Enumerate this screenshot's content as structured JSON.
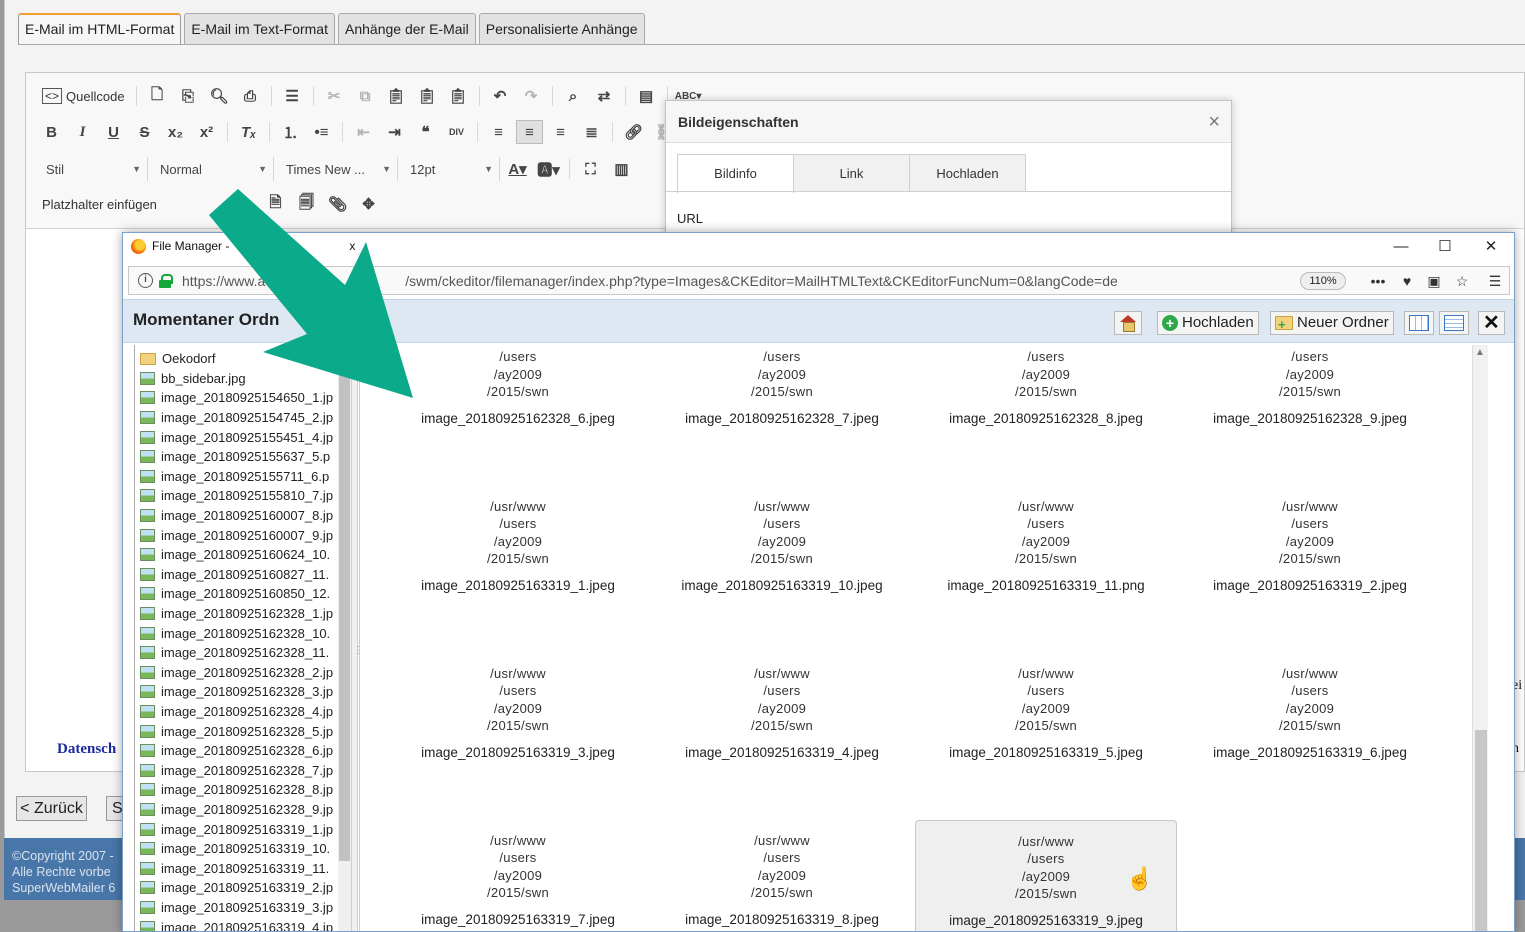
{
  "app": {
    "tabs": [
      "E-Mail im HTML-Format",
      "E-Mail im Text-Format",
      "Anhänge der E-Mail",
      "Personalisierte Anhänge"
    ],
    "toolbar": {
      "source_label": "Quellcode",
      "style_combo": "Stil",
      "format_combo": "Normal",
      "font_combo": "Times New ...",
      "size_combo": "12pt",
      "placeholder_label": "Platzhalter einfügen"
    },
    "body_fragments": {
      "datenschutz": "Datensch",
      "right_top": "ei",
      "right_bottom": "n"
    },
    "buttons": {
      "back": "< Zurück",
      "next": "S"
    },
    "footer": [
      "©Copyright 2007 -",
      "Alle Rechte vorbe",
      "SuperWebMailer 6"
    ]
  },
  "image_dialog": {
    "title": "Bildeigenschaften",
    "close_icon": "×",
    "tabs": [
      "Bildinfo",
      "Link",
      "Hochladen"
    ],
    "active_tab": "Bildinfo",
    "url_label": "URL"
  },
  "file_manager": {
    "window_title": "File Manager -",
    "window_title_suffix": "x",
    "url_prefix": "https://www.a",
    "url": "/swm/ckeditor/filemanager/index.php?type=Images&CKEditor=MailHTMLText&CKEditorFuncNum=0&langCode=de",
    "zoom": "110%",
    "header_title": "Momentaner Ordn",
    "buttons": {
      "upload": "Hochladen",
      "new_folder": "Neuer Ordner"
    },
    "tree_items": [
      {
        "label": "Oekodorf",
        "type": "folder"
      },
      {
        "label": "bb_sidebar.jpg",
        "type": "image"
      },
      {
        "label": "image_20180925154650_1.jp",
        "type": "image"
      },
      {
        "label": "image_20180925154745_2.jp",
        "type": "image"
      },
      {
        "label": "image_20180925155451_4.jp",
        "type": "image"
      },
      {
        "label": "image_20180925155637_5.p",
        "type": "image"
      },
      {
        "label": "image_20180925155711_6.p",
        "type": "image"
      },
      {
        "label": "image_20180925155810_7.jp",
        "type": "image"
      },
      {
        "label": "image_20180925160007_8.jp",
        "type": "image"
      },
      {
        "label": "image_20180925160007_9.jp",
        "type": "image"
      },
      {
        "label": "image_20180925160624_10.",
        "type": "image"
      },
      {
        "label": "image_20180925160827_11.",
        "type": "image"
      },
      {
        "label": "image_20180925160850_12.",
        "type": "image"
      },
      {
        "label": "image_20180925162328_1.jp",
        "type": "image"
      },
      {
        "label": "image_20180925162328_10.",
        "type": "image"
      },
      {
        "label": "image_20180925162328_11.",
        "type": "image"
      },
      {
        "label": "image_20180925162328_2.jp",
        "type": "image"
      },
      {
        "label": "image_20180925162328_3.jp",
        "type": "image"
      },
      {
        "label": "image_20180925162328_4.jp",
        "type": "image"
      },
      {
        "label": "image_20180925162328_5.jp",
        "type": "image"
      },
      {
        "label": "image_20180925162328_6.jp",
        "type": "image"
      },
      {
        "label": "image_20180925162328_7.jp",
        "type": "image"
      },
      {
        "label": "image_20180925162328_8.jp",
        "type": "image"
      },
      {
        "label": "image_20180925162328_9.jp",
        "type": "image"
      },
      {
        "label": "image_20180925163319_1.jp",
        "type": "image"
      },
      {
        "label": "image_20180925163319_10.",
        "type": "image"
      },
      {
        "label": "image_20180925163319_11.",
        "type": "image"
      },
      {
        "label": "image_20180925163319_2.jp",
        "type": "image"
      },
      {
        "label": "image_20180925163319_3.jp",
        "type": "image"
      },
      {
        "label": "image_20180925163319_4.jp",
        "type": "image"
      }
    ],
    "path_lines": [
      "/usr/www",
      "/users",
      "/ay2009",
      "/2015/swn"
    ],
    "grid_items": [
      "image_20180925162328_6.jpeg",
      "image_20180925162328_7.jpeg",
      "image_20180925162328_8.jpeg",
      "image_20180925162328_9.jpeg",
      "image_20180925163319_1.jpeg",
      "image_20180925163319_10.jpeg",
      "image_20180925163319_11.png",
      "image_20180925163319_2.jpeg",
      "image_20180925163319_3.jpeg",
      "image_20180925163319_4.jpeg",
      "image_20180925163319_5.jpeg",
      "image_20180925163319_6.jpeg",
      "image_20180925163319_7.jpeg",
      "image_20180925163319_8.jpeg",
      "image_20180925163319_9.jpeg"
    ],
    "hovered_item": "image_20180925163319_9.jpeg"
  },
  "annotation": {
    "arrow_color": "#0aaa8a"
  }
}
